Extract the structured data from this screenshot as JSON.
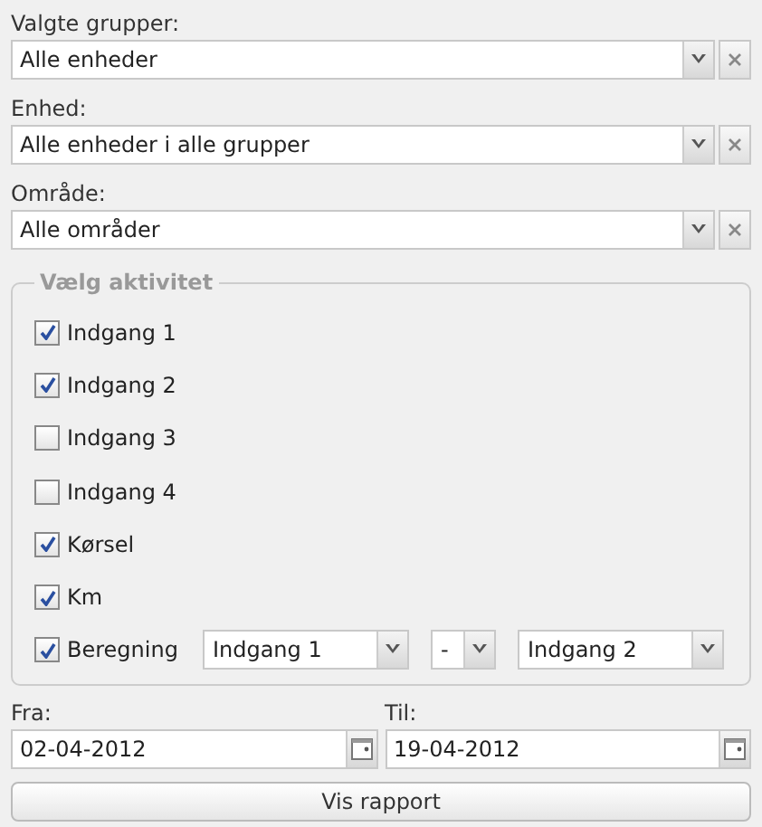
{
  "selects": [
    {
      "label": "Valgte grupper:",
      "value": "Alle enheder"
    },
    {
      "label": "Enhed:",
      "value": "Alle enheder i alle grupper"
    },
    {
      "label": "Område:",
      "value": "Alle områder"
    }
  ],
  "activity": {
    "legend": "Vælg aktivitet",
    "items": [
      {
        "kind": "check",
        "label": "Indgang 1",
        "checked": true
      },
      {
        "kind": "check",
        "label": "Indgang 2",
        "checked": true
      },
      {
        "kind": "check",
        "label": "Indgang 3",
        "checked": false
      },
      {
        "kind": "check",
        "label": "Indgang 4",
        "checked": false
      },
      {
        "kind": "check",
        "label": "Kørsel",
        "checked": true
      },
      {
        "kind": "check",
        "label": "Km",
        "checked": true
      },
      {
        "kind": "calc",
        "label": "Beregning",
        "checked": true,
        "left": "Indgang 1",
        "operator": "-",
        "right": "Indgang 2"
      }
    ]
  },
  "dates": [
    {
      "label": "Fra:",
      "value": "02-04-2012"
    },
    {
      "label": "Til:",
      "value": "19-04-2012"
    }
  ],
  "button": "Vis rapport"
}
